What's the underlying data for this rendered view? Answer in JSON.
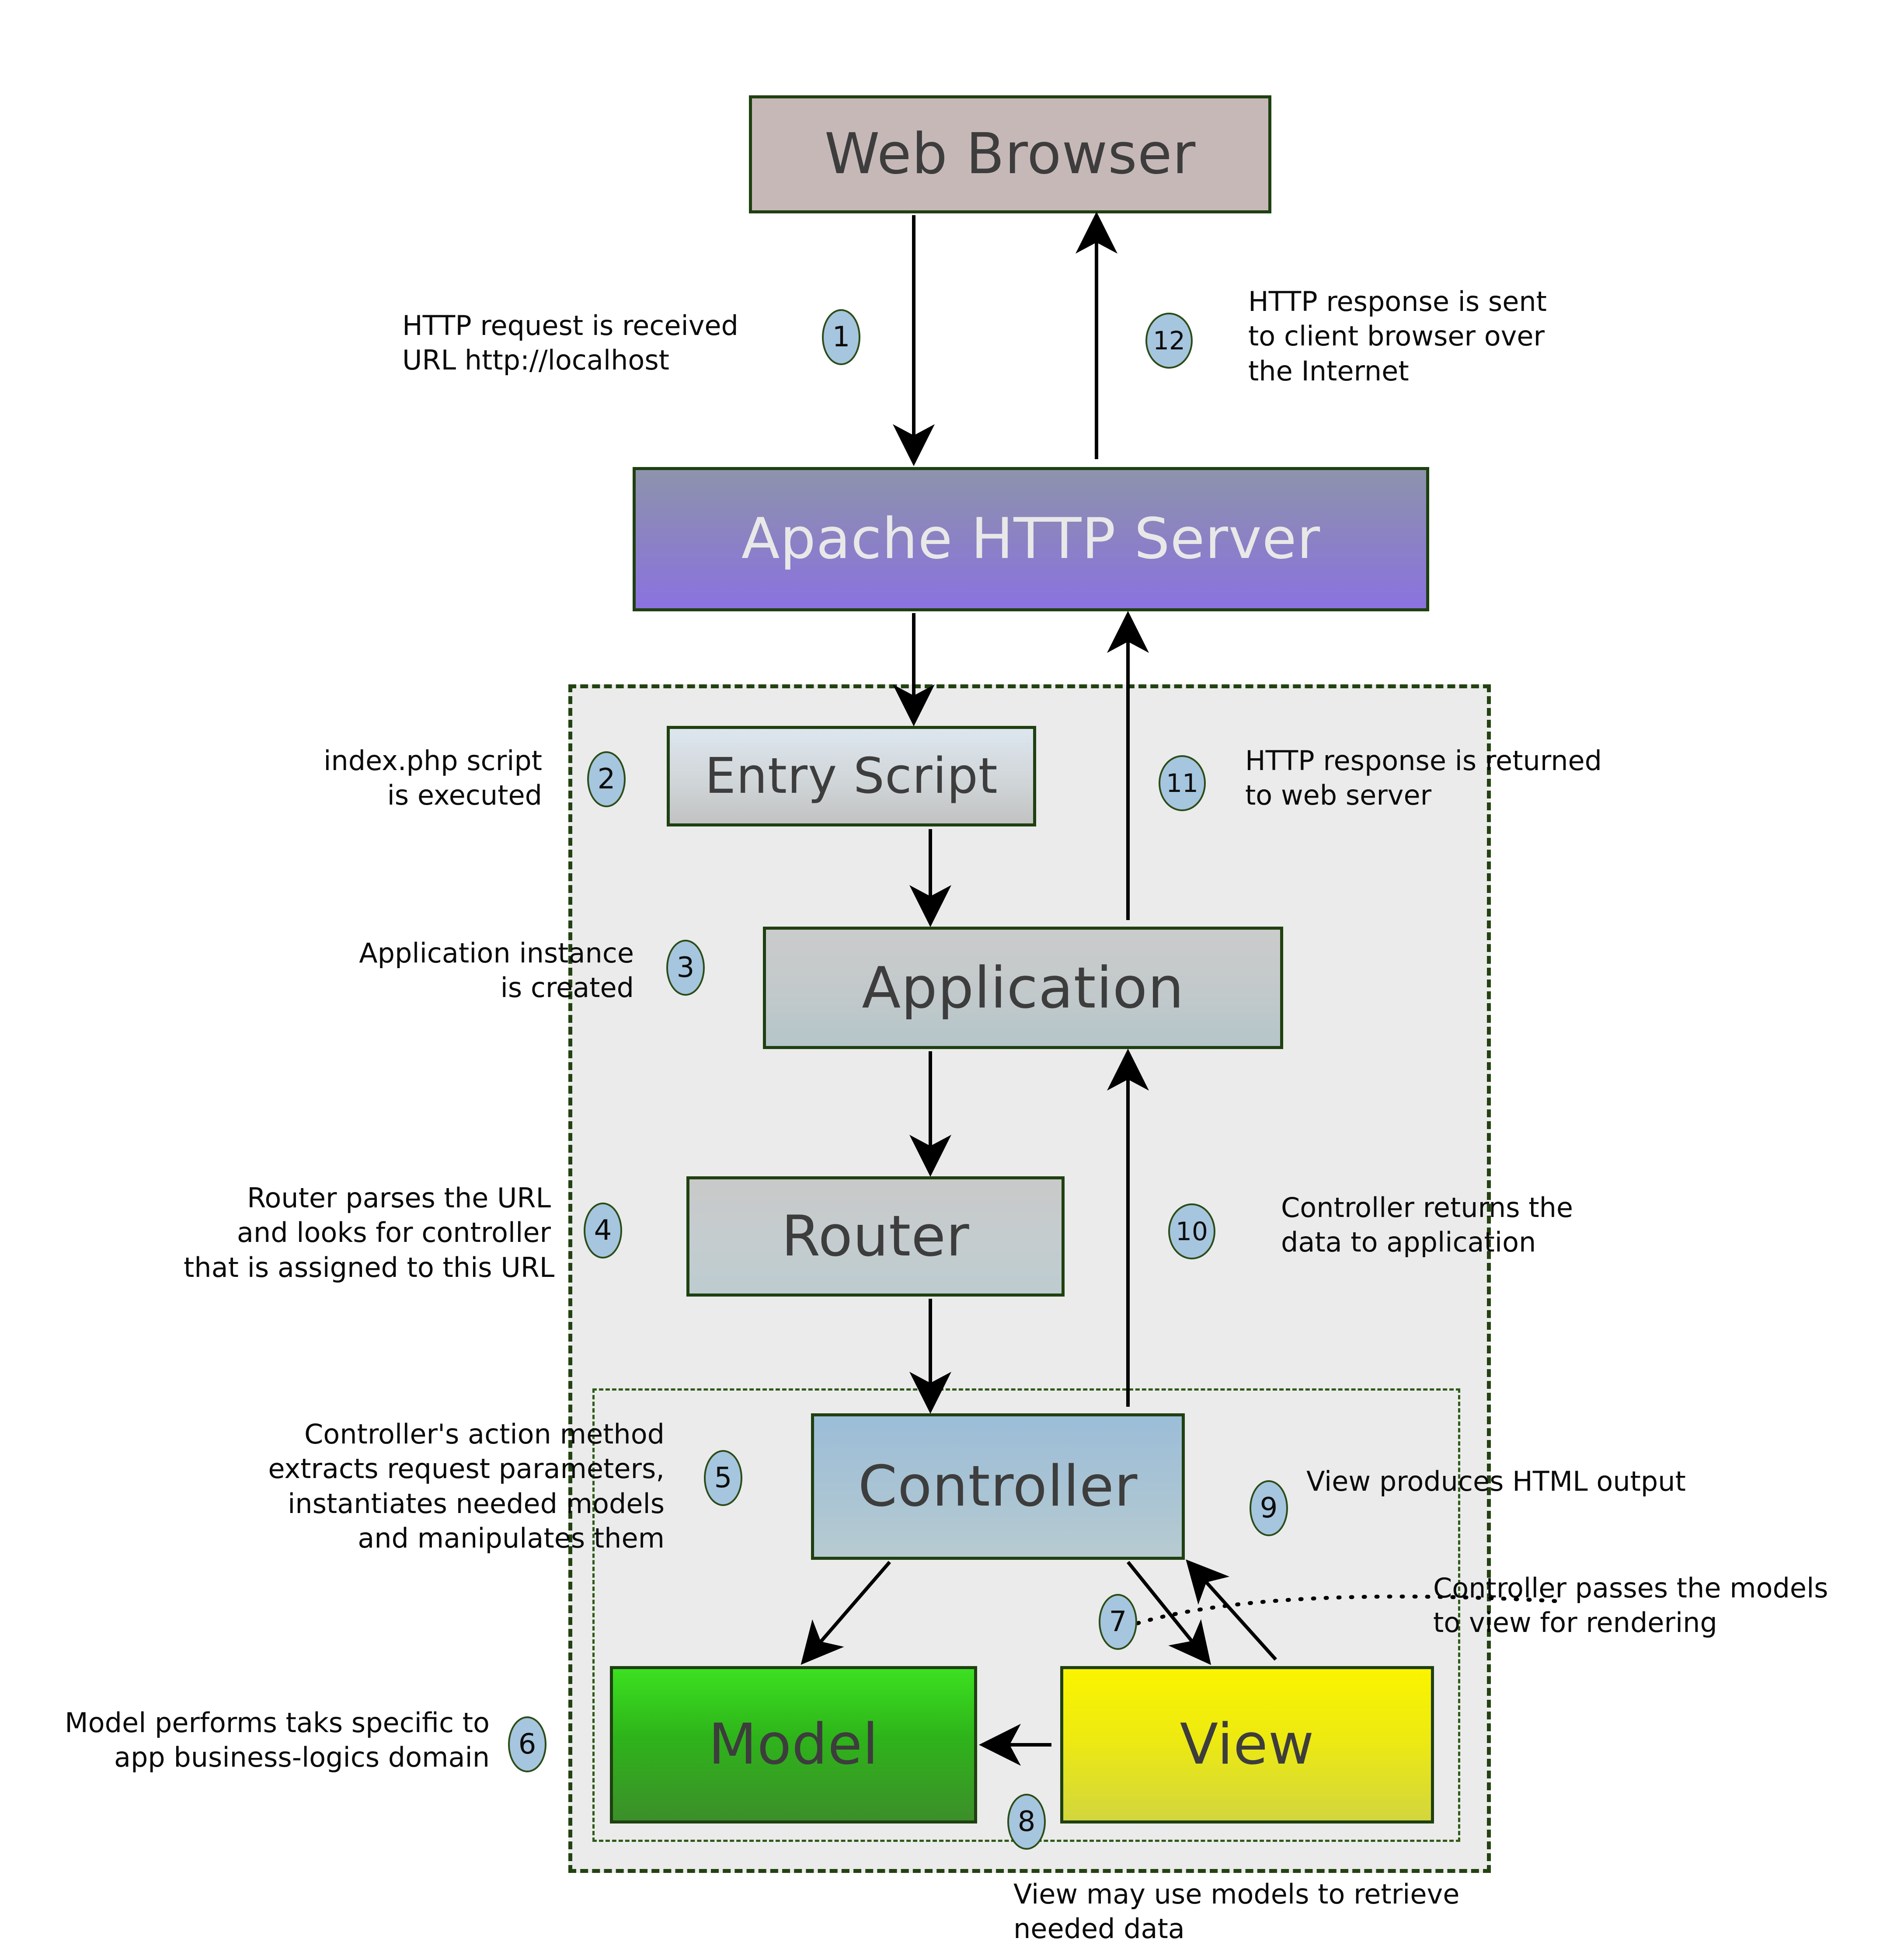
{
  "diagram": {
    "title": "MVC request lifecycle",
    "colors": {
      "browser_fill": "#c7b8b8",
      "apache_fill_top": "#8d93ac",
      "apache_fill_bottom": "#8b72e0",
      "node_border": "#1f4011",
      "region_fill": "#ebebeb",
      "region_border": "#234211",
      "badge_fill": "#a6c5de",
      "badge_border": "#2c4d18",
      "model_fill_top": "#3ce020",
      "model_fill_bottom": "#3c8f2a",
      "view_fill_top": "#faf400",
      "view_fill_bottom": "#d2d63d",
      "controller_fill_top": "#9cbdd8",
      "controller_fill_bottom": "#b7cbd1"
    },
    "nodes": {
      "browser": "Web Browser",
      "apache": "Apache HTTP Server",
      "entry_script": "Entry Script",
      "application": "Application",
      "router": "Router",
      "controller": "Controller",
      "model": "Model",
      "view": "View"
    },
    "steps": [
      {
        "number": "1",
        "text": "HTTP request is received\nURL http://localhost"
      },
      {
        "number": "2",
        "text": "index.php script\nis executed"
      },
      {
        "number": "3",
        "text": "Application instance\nis created"
      },
      {
        "number": "4",
        "text": "Router parses the URL\nand looks for controller\nthat is assigned to this URL"
      },
      {
        "number": "5",
        "text": "Controller's action method\nextracts request parameters,\ninstantiates needed models\nand manipulates them"
      },
      {
        "number": "6",
        "text": "Model performs taks specific to\napp business-logics domain"
      },
      {
        "number": "7",
        "text": "Controller passes the models\nto view for rendering"
      },
      {
        "number": "8",
        "text": "View may use models to retrieve\nneeded data"
      },
      {
        "number": "9",
        "text": "View produces HTML output"
      },
      {
        "number": "10",
        "text": "Controller returns the\ndata to application"
      },
      {
        "number": "11",
        "text": "HTTP response is returned\nto web server"
      },
      {
        "number": "12",
        "text": "HTTP response is sent\nto client browser over\nthe Internet"
      }
    ]
  }
}
